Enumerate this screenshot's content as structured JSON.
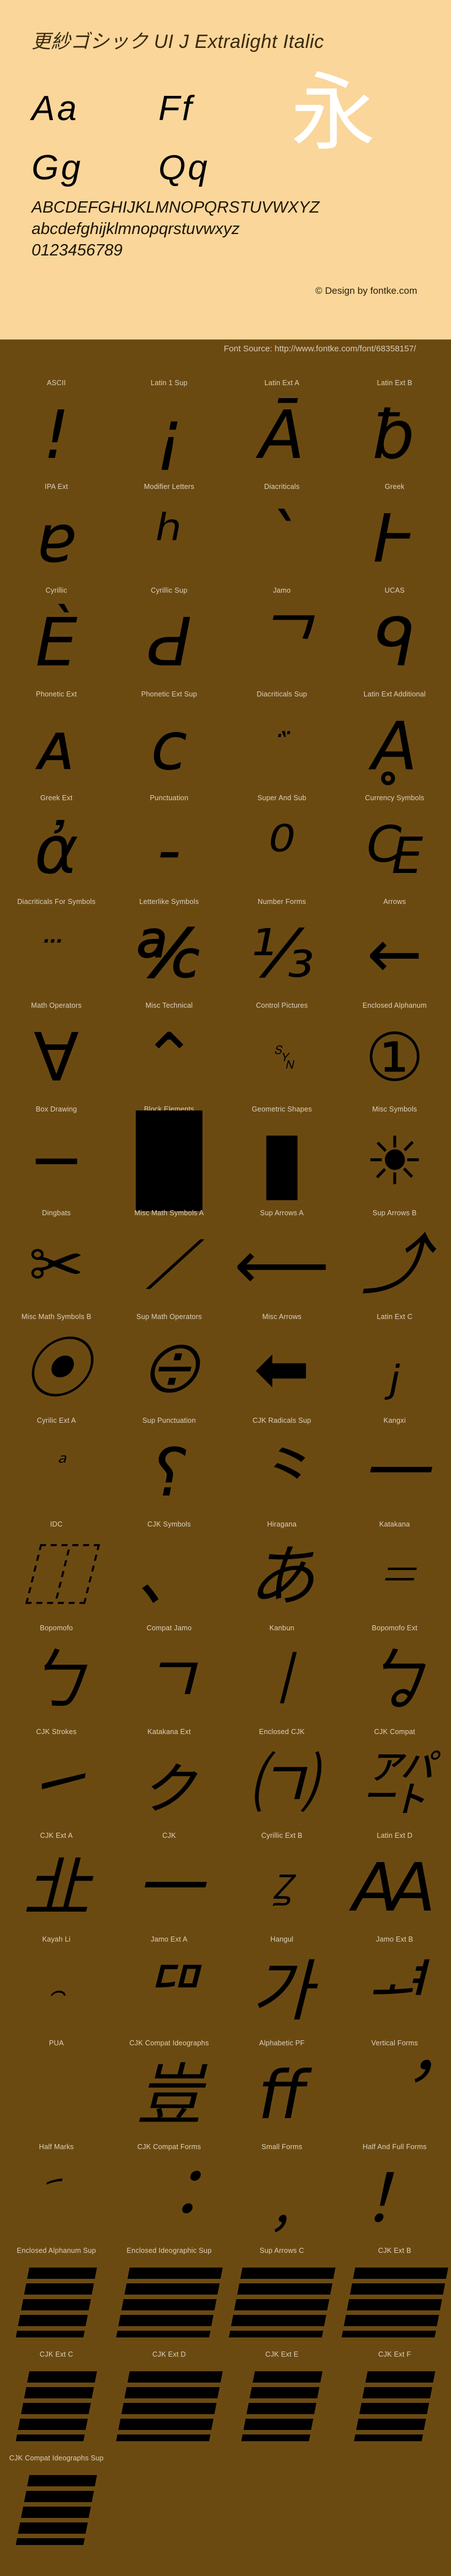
{
  "header": {
    "title": "更紗ゴシック UI J Extralight Italic",
    "letter_pairs": [
      "Aa",
      "Ff",
      "Gg",
      "Qq"
    ],
    "cjk_sample": "永",
    "alphabet_upper": "ABCDEFGHIJKLMNOPQRSTUVWXYZ",
    "alphabet_lower": "abcdefghijklmnopqrstuvwxyz",
    "digits": "0123456789",
    "copyright": "© Design by fontke.com",
    "background_color": "#fad69a"
  },
  "source_bar": {
    "text": "Font Source: http://www.fontke.com/font/68358157/",
    "background_color": "#6b4a12"
  },
  "grid": {
    "columns": 4,
    "label_color": "#ddd2bc",
    "glyph_color": "#000000",
    "cells": [
      {
        "label": "ASCII",
        "glyph": "!",
        "kind": "text",
        "size": "big"
      },
      {
        "label": "Latin 1 Sup",
        "glyph": "¡",
        "kind": "text",
        "size": "big"
      },
      {
        "label": "Latin Ext A",
        "glyph": "Ā",
        "kind": "text",
        "size": "big"
      },
      {
        "label": "Latin Ext B",
        "glyph": "ƀ",
        "kind": "text",
        "size": "big"
      },
      {
        "label": "IPA Ext",
        "glyph": "ɐ",
        "kind": "text",
        "size": "big"
      },
      {
        "label": "Modifier Letters",
        "glyph": "ʰ",
        "kind": "text",
        "size": "big"
      },
      {
        "label": "Diacriticals",
        "glyph": "ˋ",
        "kind": "text",
        "size": "big"
      },
      {
        "label": "Greek",
        "glyph": "Ͱ",
        "kind": "text",
        "size": "big"
      },
      {
        "label": "Cyrillic",
        "glyph": "Ѐ",
        "kind": "text",
        "size": "big"
      },
      {
        "label": "Cyrillic Sup",
        "glyph": "Ԁ",
        "kind": "text",
        "size": "big"
      },
      {
        "label": "Jamo",
        "glyph": "ᄀ",
        "kind": "text",
        "size": "big"
      },
      {
        "label": "UCAS",
        "glyph": "ᑫ",
        "kind": "text",
        "size": "big"
      },
      {
        "label": "Phonetic Ext",
        "glyph": "ᴀ",
        "kind": "text",
        "size": "big"
      },
      {
        "label": "Phonetic Ext Sup",
        "glyph": "ᴄ",
        "kind": "text",
        "size": "big"
      },
      {
        "label": "Diacriticals Sup",
        "glyph": "᷀",
        "kind": "text",
        "size": "small"
      },
      {
        "label": "Latin Ext Additional",
        "glyph": "Ḁ",
        "kind": "text",
        "size": "big"
      },
      {
        "label": "Greek Ext",
        "glyph": "ἀ",
        "kind": "text",
        "size": "big"
      },
      {
        "label": "Punctuation",
        "glyph": "‐",
        "kind": "text",
        "size": "big"
      },
      {
        "label": "Super And Sub",
        "glyph": "⁰",
        "kind": "text",
        "size": "big"
      },
      {
        "label": "Currency Symbols",
        "glyph": "₠",
        "kind": "text",
        "size": "big"
      },
      {
        "label": "Diacriticals For Symbols",
        "glyph": "⃛",
        "kind": "text",
        "size": "small"
      },
      {
        "label": "Letterlike Symbols",
        "glyph": "℀",
        "kind": "text",
        "size": "big"
      },
      {
        "label": "Number Forms",
        "glyph": "⅓",
        "kind": "text",
        "size": "big"
      },
      {
        "label": "Arrows",
        "glyph": "←",
        "kind": "text",
        "size": "big"
      },
      {
        "label": "Math Operators",
        "glyph": "∀",
        "kind": "text",
        "size": "big"
      },
      {
        "label": "Misc Technical",
        "glyph": "⌃",
        "kind": "text",
        "size": "big"
      },
      {
        "label": "Control Pictures",
        "glyph": "␖",
        "kind": "text",
        "size": "small"
      },
      {
        "label": "Enclosed Alphanum",
        "glyph": "①",
        "kind": "text",
        "size": "big"
      },
      {
        "label": "Box Drawing",
        "glyph": "─",
        "kind": "text",
        "size": "big"
      },
      {
        "label": "Block Elements",
        "glyph": "█",
        "kind": "text",
        "size": "blk"
      },
      {
        "label": "Geometric Shapes",
        "glyph": "▮",
        "kind": "text",
        "size": "blk"
      },
      {
        "label": "Misc Symbols",
        "glyph": "☀",
        "kind": "text",
        "size": "big"
      },
      {
        "label": "Dingbats",
        "glyph": "✂",
        "kind": "text",
        "size": "big"
      },
      {
        "label": "Misc Math Symbols A",
        "glyph": "⟋",
        "kind": "text",
        "size": "big"
      },
      {
        "label": "Sup Arrows A",
        "glyph": "⟵",
        "kind": "text",
        "size": "big"
      },
      {
        "label": "Sup Arrows B",
        "glyph": "⤴",
        "kind": "text",
        "size": "big"
      },
      {
        "label": "Misc Math Symbols B",
        "glyph": "⦿",
        "kind": "text",
        "size": "big"
      },
      {
        "label": "Sup Math Operators",
        "glyph": "⨸",
        "kind": "text",
        "size": "big"
      },
      {
        "label": "Misc Arrows",
        "glyph": "⬅",
        "kind": "text",
        "size": "big"
      },
      {
        "label": "Latin Ext C",
        "glyph": "ⱼ",
        "kind": "text",
        "size": "big"
      },
      {
        "label": "Cyrilic Ext A",
        "glyph": "ⷶ",
        "kind": "text",
        "size": "small"
      },
      {
        "label": "Sup Punctuation",
        "glyph": "⸮",
        "kind": "text",
        "size": "big"
      },
      {
        "label": "CJK Radicals Sup",
        "glyph": "⺀",
        "kind": "text",
        "size": "big"
      },
      {
        "label": "Kangxi",
        "glyph": "⼀",
        "kind": "text",
        "size": "big"
      },
      {
        "label": "IDC",
        "glyph": "⿰",
        "kind": "text",
        "size": "big"
      },
      {
        "label": "CJK Symbols",
        "glyph": "、",
        "kind": "text",
        "size": "big"
      },
      {
        "label": "Hiragana",
        "glyph": "あ",
        "kind": "text",
        "size": "big"
      },
      {
        "label": "Katakana",
        "glyph": "゠",
        "kind": "text",
        "size": "big"
      },
      {
        "label": "Bopomofo",
        "glyph": "ㄅ",
        "kind": "text",
        "size": "big"
      },
      {
        "label": "Compat Jamo",
        "glyph": "ㄱ",
        "kind": "text",
        "size": "big"
      },
      {
        "label": "Kanbun",
        "glyph": "㆐",
        "kind": "text",
        "size": "big"
      },
      {
        "label": "Bopomofo Ext",
        "glyph": "ㆠ",
        "kind": "text",
        "size": "big"
      },
      {
        "label": "CJK Strokes",
        "glyph": "㇀",
        "kind": "text",
        "size": "big"
      },
      {
        "label": "Katakana Ext",
        "glyph": "ㇰ",
        "kind": "text",
        "size": "big"
      },
      {
        "label": "Enclosed CJK",
        "glyph": "㈀",
        "kind": "text",
        "size": "big"
      },
      {
        "label": "CJK Compat",
        "glyph": "㌀",
        "kind": "text",
        "size": "big"
      },
      {
        "label": "CJK Ext A",
        "glyph": "㐀",
        "kind": "text",
        "size": "big"
      },
      {
        "label": "CJK",
        "glyph": "一",
        "kind": "text",
        "size": "big"
      },
      {
        "label": "Cyrillic Ext B",
        "glyph": "Ꙁ",
        "kind": "text",
        "size": "small"
      },
      {
        "label": "Latin Ext D",
        "glyph": "Ꜳ",
        "kind": "text",
        "size": "big"
      },
      {
        "label": "Kayah Li",
        "glyph": "꤮",
        "kind": "text",
        "size": "small"
      },
      {
        "label": "Jamo Ext A",
        "glyph": "ꥠ",
        "kind": "text",
        "size": "big"
      },
      {
        "label": "Hangul",
        "glyph": "가",
        "kind": "text",
        "size": "big"
      },
      {
        "label": "Jamo Ext B",
        "glyph": "ힰ",
        "kind": "text",
        "size": "big"
      },
      {
        "label": "PUA",
        "glyph": "",
        "kind": "text",
        "size": "big"
      },
      {
        "label": "CJK Compat Ideographs",
        "glyph": "豈",
        "kind": "text",
        "size": "big"
      },
      {
        "label": "Alphabetic PF",
        "glyph": "ﬀ",
        "kind": "text",
        "size": "big"
      },
      {
        "label": "Vertical Forms",
        "glyph": "︐",
        "kind": "text",
        "size": "big"
      },
      {
        "label": "Half Marks",
        "glyph": "︠",
        "kind": "text",
        "size": "small"
      },
      {
        "label": "CJK Compat Forms",
        "glyph": "︓",
        "kind": "text",
        "size": "big"
      },
      {
        "label": "Small Forms",
        "glyph": "﹐",
        "kind": "text",
        "size": "big"
      },
      {
        "label": "Half And Full Forms",
        "glyph": "！",
        "kind": "text",
        "size": "big"
      },
      {
        "label": "Enclosed Alphanum Sup",
        "glyph": "tofu",
        "kind": "tofu",
        "size": "wide"
      },
      {
        "label": "Enclosed Ideographic Sup",
        "glyph": "tofu",
        "kind": "tofu",
        "size": "extra"
      },
      {
        "label": "Sup Arrows C",
        "glyph": "tofu",
        "kind": "tofu",
        "size": "extra"
      },
      {
        "label": "CJK Ext B",
        "glyph": "tofu",
        "kind": "tofu",
        "size": "extra"
      },
      {
        "label": "CJK Ext C",
        "glyph": "tofu",
        "kind": "tofu",
        "size": "wide"
      },
      {
        "label": "CJK Ext D",
        "glyph": "tofu",
        "kind": "tofu",
        "size": "extra"
      },
      {
        "label": "CJK Ext E",
        "glyph": "tofu",
        "kind": "tofu",
        "size": "wide"
      },
      {
        "label": "CJK Ext F",
        "glyph": "tofu",
        "kind": "tofu",
        "size": "wide"
      },
      {
        "label": "CJK Compat Ideographs Sup",
        "glyph": "tofu",
        "kind": "tofu",
        "size": "wide"
      }
    ]
  }
}
